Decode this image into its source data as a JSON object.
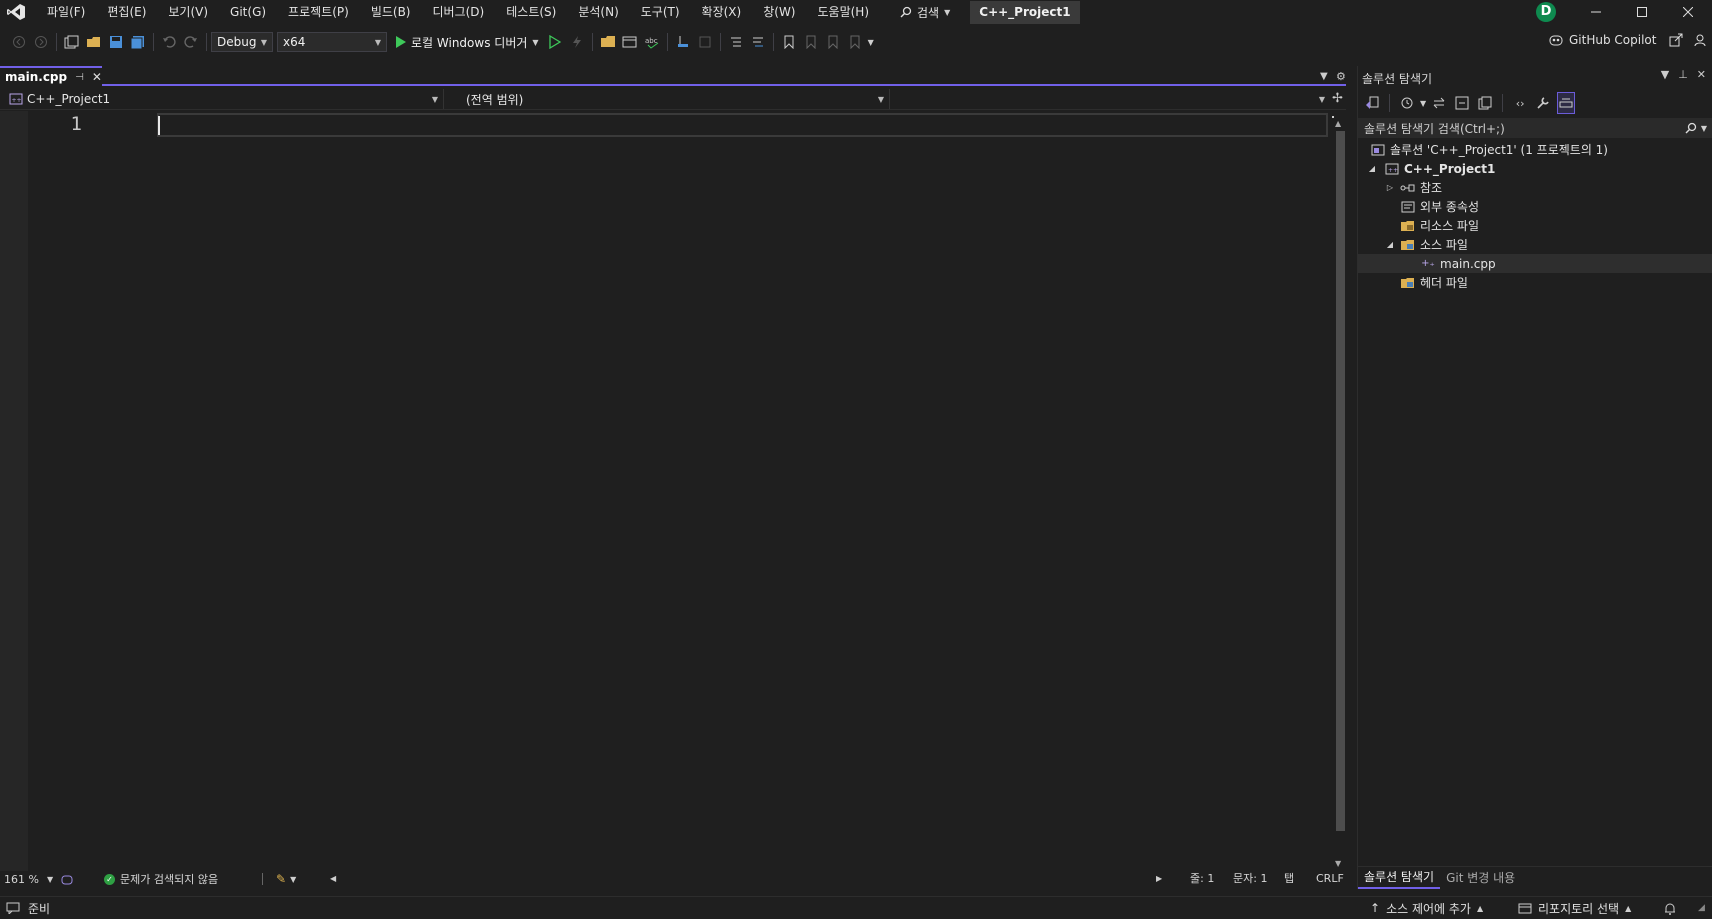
{
  "menubar": {
    "items": [
      "파일(F)",
      "편집(E)",
      "보기(V)",
      "Git(G)",
      "프로젝트(P)",
      "빌드(B)",
      "디버그(D)",
      "테스트(S)",
      "분석(N)",
      "도구(T)",
      "확장(X)",
      "창(W)",
      "도움말(H)"
    ],
    "search_label": "검색",
    "project_title": "C++_Project1",
    "avatar_initial": "D"
  },
  "toolbar": {
    "configuration": "Debug",
    "platform": "x64",
    "run_label": "로컬 Windows 디버거",
    "copilot_label": "GitHub Copilot"
  },
  "editor": {
    "tab_name": "main.cpp",
    "nav_project": "C++_Project1",
    "nav_scope": "(전역 범위)",
    "nav_member": "",
    "line_numbers": [
      "1"
    ],
    "zoom": "161 %",
    "issues_label": "문제가 검색되지 않음",
    "line_label": "줄: 1",
    "char_label": "문자: 1",
    "tab_mode": "탭",
    "line_ending": "CRLF"
  },
  "solution_explorer": {
    "title": "솔루션 탐색기",
    "search_placeholder": "솔루션 탐색기 검색(Ctrl+;)",
    "tree": {
      "solution": "솔루션 'C++_Project1' (1 프로젝트의 1)",
      "project": "C++_Project1",
      "references": "참조",
      "external_deps": "외부 종속성",
      "resource_files": "리소스 파일",
      "source_files": "소스 파일",
      "main_cpp": "main.cpp",
      "header_files": "헤더 파일"
    },
    "tabs": {
      "explorer": "솔루션 탐색기",
      "git_changes": "Git 변경 내용"
    }
  },
  "statusbar": {
    "ready": "준비",
    "source_control": "소스 제어에 추가",
    "repository": "리포지토리 선택"
  },
  "colors": {
    "accent": "#7160e8",
    "background": "#1f1f1f",
    "run_green": "#3ec95a",
    "avatar_green": "#0e8a4f"
  }
}
